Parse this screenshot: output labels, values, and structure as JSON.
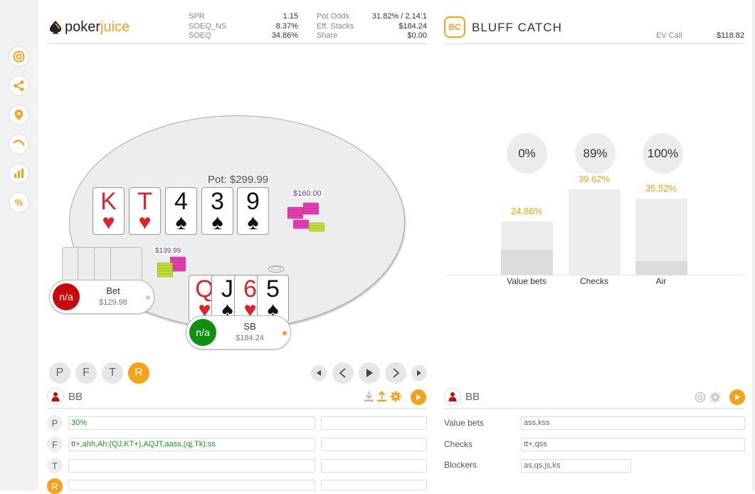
{
  "brand": {
    "name_a": "poker",
    "name_b": "juice"
  },
  "colors": {
    "accent": "#f7a11a",
    "win_green": "#1a9a1a",
    "loss_red": "#c80a0a"
  },
  "sidebar": {
    "items": [
      {
        "name": "support-icon",
        "glyph": "◎"
      },
      {
        "name": "share-icon",
        "glyph": "⋖"
      },
      {
        "name": "location-pin-icon",
        "glyph": "⚲"
      },
      {
        "name": "arc-icon",
        "glyph": "◝"
      },
      {
        "name": "bar-chart-icon",
        "glyph": "▥"
      },
      {
        "name": "percent-icon",
        "glyph": "%"
      }
    ]
  },
  "stats_left": [
    {
      "label": "SPR",
      "value": "1.15"
    },
    {
      "label": "SOEQ_NS",
      "value": "8.37%"
    },
    {
      "label": "SOEQ",
      "value": "34.86%"
    }
  ],
  "stats_mid": [
    {
      "label": "Pot Odds",
      "value": "31.82% / 2.14:1"
    },
    {
      "label": "Eff. Stacks",
      "value": "$184.24"
    },
    {
      "label": "Share",
      "value": "$0.00"
    }
  ],
  "analysis": {
    "badge": "BC",
    "title": "BLUFF CATCH",
    "ev_label": "EV Call",
    "ev_value": "$118.82",
    "bubbles": [
      "0%",
      "89%",
      "100%"
    ]
  },
  "chart_data": {
    "type": "bar",
    "categories": [
      "Value bets",
      "Checks",
      "Air"
    ],
    "values": [
      24.86,
      39.62,
      35.52
    ],
    "value_labels": [
      "24.86%",
      "39.62%",
      "35.52%"
    ],
    "ylim": [
      0,
      40
    ],
    "inner_fill_fraction": [
      0.47,
      0.0,
      0.18
    ],
    "grid": false
  },
  "table": {
    "pot": "Pot: $299.99",
    "board": [
      {
        "rank": "K",
        "suit": "♥",
        "color": "red"
      },
      {
        "rank": "T",
        "suit": "♥",
        "color": "red"
      },
      {
        "rank": "4",
        "suit": "♠",
        "color": "black"
      },
      {
        "rank": "3",
        "suit": "♠",
        "color": "black"
      },
      {
        "rank": "9",
        "suit": "♠",
        "color": "black"
      }
    ],
    "bet_main": "$160.00",
    "bet_bb": "$139.99",
    "hero_cards": [
      {
        "rank": "Q",
        "suit": "♥",
        "color": "red"
      },
      {
        "rank": "J",
        "suit": "♠",
        "color": "black"
      },
      {
        "rank": "6",
        "suit": "♥",
        "color": "red"
      },
      {
        "rank": "5",
        "suit": "♠",
        "color": "black"
      }
    ],
    "seat_bb": {
      "avatar": "n/a",
      "name": "Bet",
      "stack": "$129.98"
    },
    "seat_sb": {
      "avatar": "n/a",
      "name": "SB",
      "stack": "$184.24"
    }
  },
  "streets": [
    "P",
    "F",
    "T",
    "R"
  ],
  "active_street": "R",
  "left_panel": {
    "player": "BB",
    "rows": [
      {
        "letter": "P",
        "range": "30%",
        "extra": ""
      },
      {
        "letter": "F",
        "range": "tt+,ahh,Ah:(QJ,KT+),AQJT,aass,(qj,Tk):ss",
        "extra": ""
      },
      {
        "letter": "T",
        "range": "",
        "extra": ""
      },
      {
        "letter": "R",
        "range": "",
        "extra": ""
      }
    ]
  },
  "right_panel": {
    "player": "BB",
    "rows": [
      {
        "label": "Value bets",
        "value": "ass,kss"
      },
      {
        "label": "Checks",
        "value": "tt+,qss"
      },
      {
        "label": "Blockers",
        "value": "as,qs,js,ks"
      }
    ]
  }
}
